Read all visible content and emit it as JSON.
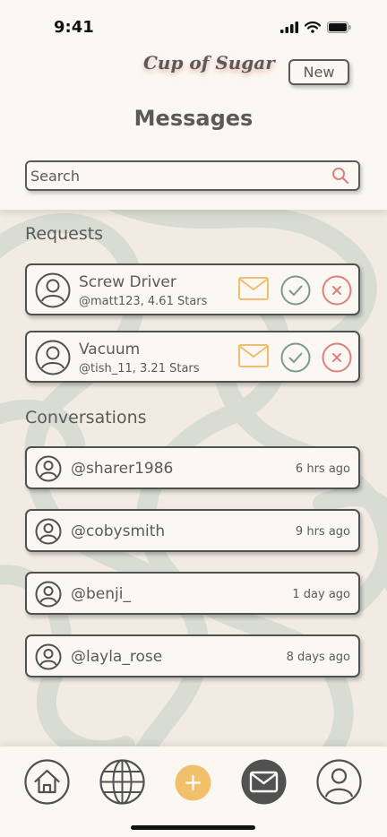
{
  "status": {
    "time": "9:41"
  },
  "header": {
    "logo": "Cup of Sugar",
    "new_label": "New",
    "title": "Messages"
  },
  "search": {
    "placeholder": "Search"
  },
  "requests": {
    "heading": "Requests",
    "items": [
      {
        "title": "Screw Driver",
        "subtitle": "@matt123, 4.61 Stars"
      },
      {
        "title": "Vacuum",
        "subtitle": "@tish_11, 3.21 Stars"
      }
    ]
  },
  "conversations": {
    "heading": "Conversations",
    "items": [
      {
        "user": "@sharer1986",
        "time": "6 hrs ago"
      },
      {
        "user": "@cobysmith",
        "time": "9 hrs ago"
      },
      {
        "user": "@benji_",
        "time": "1 day ago"
      },
      {
        "user": "@layla_rose",
        "time": "8 days ago"
      }
    ]
  },
  "tabs": [
    {
      "icon": "home-icon",
      "active": false
    },
    {
      "icon": "globe-icon",
      "active": false
    },
    {
      "icon": "plus-icon",
      "active": false
    },
    {
      "icon": "mail-icon",
      "active": true
    },
    {
      "icon": "profile-icon",
      "active": false
    }
  ],
  "colors": {
    "background": "#fbf8f4",
    "pattern": "#d8dcd3",
    "text": "#5a5a58",
    "accept": "#7a9a8c",
    "decline": "#de7f7c",
    "message": "#f0be6e",
    "plus": "#f0c06a",
    "active_tab": "#4f5250"
  }
}
